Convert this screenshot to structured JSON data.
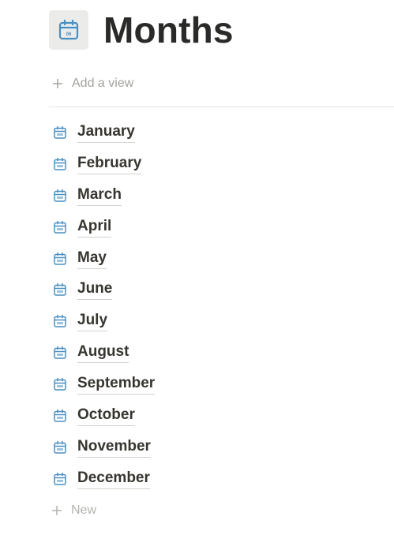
{
  "page": {
    "title": "Months",
    "title_icon": "calendar-icon",
    "title_icon_badge": "06"
  },
  "toolbar": {
    "add_view_label": "Add a view"
  },
  "months": {
    "items": [
      {
        "label": "January",
        "icon": "calendar-icon"
      },
      {
        "label": "February",
        "icon": "calendar-icon"
      },
      {
        "label": "March",
        "icon": "calendar-icon"
      },
      {
        "label": "April",
        "icon": "calendar-icon"
      },
      {
        "label": "May",
        "icon": "calendar-icon"
      },
      {
        "label": "June",
        "icon": "calendar-icon"
      },
      {
        "label": "July",
        "icon": "calendar-icon"
      },
      {
        "label": "August",
        "icon": "calendar-icon"
      },
      {
        "label": "September",
        "icon": "calendar-icon"
      },
      {
        "label": "October",
        "icon": "calendar-icon"
      },
      {
        "label": "November",
        "icon": "calendar-icon"
      },
      {
        "label": "December",
        "icon": "calendar-icon"
      }
    ],
    "new_label": "New"
  },
  "colors": {
    "icon_blue": "#4a8fc1",
    "text": "#37352f",
    "muted": "#a3a29e"
  }
}
